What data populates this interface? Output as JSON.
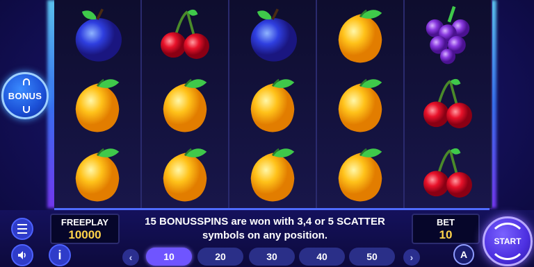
{
  "reels": [
    [
      "plum",
      "lemon",
      "lemon"
    ],
    [
      "cherry",
      "lemon",
      "lemon"
    ],
    [
      "plum",
      "lemon",
      "lemon"
    ],
    [
      "lemon",
      "lemon",
      "lemon"
    ],
    [
      "grapes",
      "cherry",
      "cherry"
    ]
  ],
  "bonus_button": {
    "label": "BONUS",
    "icon": "dollar-sign-icon"
  },
  "freeplay": {
    "label": "FREEPLAY",
    "value": "10000"
  },
  "bet": {
    "label": "BET",
    "value": "10"
  },
  "message": {
    "line1": "15 BONUSSPINS are won with 3,4 or 5 SCATTER",
    "line2": "symbols on any position."
  },
  "bet_options": [
    "10",
    "20",
    "30",
    "40",
    "50"
  ],
  "selected_bet": "10",
  "controls": {
    "menu_icon": "menu-icon",
    "sound_icon": "speaker-icon",
    "info_label": "i",
    "prev_label": "‹",
    "next_label": "›",
    "auto_label": "A",
    "start_label": "START"
  },
  "colors": {
    "background": "#14105a",
    "accent": "#6f55ff",
    "value": "#ffd34a"
  }
}
